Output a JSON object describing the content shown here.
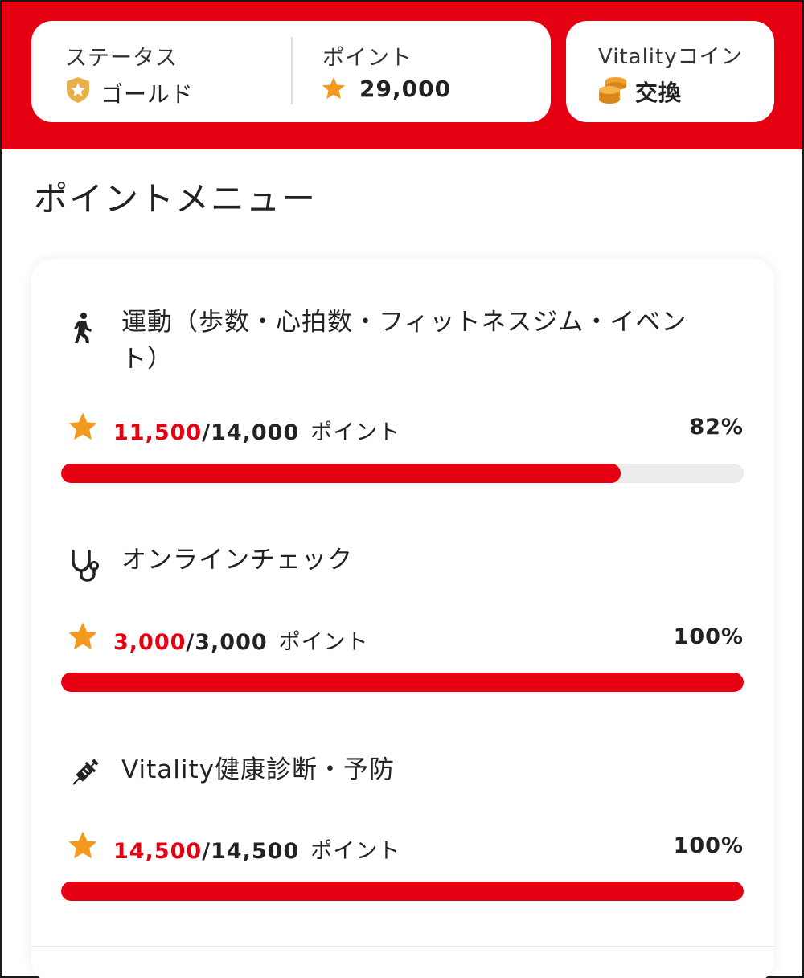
{
  "header": {
    "status": {
      "label": "ステータス",
      "value": "ゴールド",
      "badge_icon": "gold-star-badge-icon"
    },
    "points": {
      "label": "ポイント",
      "value": "29,000",
      "icon": "star-icon"
    },
    "coin": {
      "label": "Vitalityコイン",
      "action": "交換",
      "icon": "coins-icon"
    }
  },
  "section_title": "ポイントメニュー",
  "menu_items": [
    {
      "icon": "walking-person-icon",
      "title": "運動（歩数・心拍数・フィットネスジム・イベント）",
      "earned": "11,500",
      "total": "/14,000",
      "unit": "ポイント",
      "percent_label": "82%",
      "progress": 0.82
    },
    {
      "icon": "stethoscope-icon",
      "title": "オンラインチェック",
      "earned": "3,000",
      "total": "/3,000",
      "unit": "ポイント",
      "percent_label": "100%",
      "progress": 1.0
    },
    {
      "icon": "syringe-icon",
      "title": "Vitality健康診断・予防",
      "earned": "14,500",
      "total": "/14,500",
      "unit": "ポイント",
      "percent_label": "100%",
      "progress": 1.0
    }
  ],
  "colors": {
    "brand_red": "#e50012",
    "star_orange": "#f39a1e",
    "track_gray": "#ececec"
  }
}
